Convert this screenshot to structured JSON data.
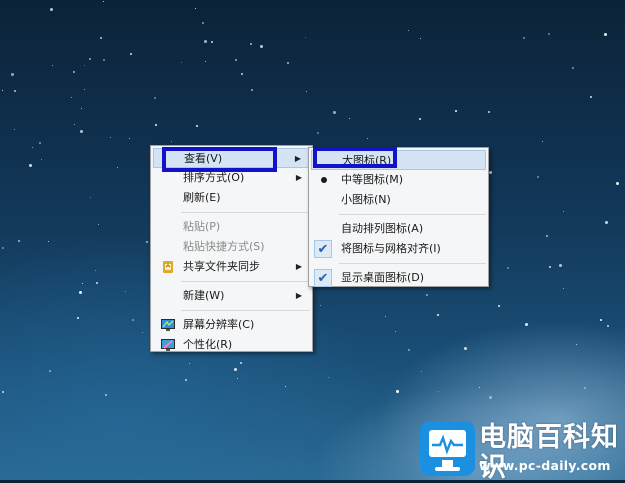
{
  "context_menu": {
    "items": [
      {
        "label": "查看(V)",
        "has_submenu": true,
        "highlighted": true
      },
      {
        "label": "排序方式(O)",
        "has_submenu": true
      },
      {
        "label": "刷新(E)"
      },
      {
        "label": "粘贴(P)",
        "disabled": true
      },
      {
        "label": "粘贴快捷方式(S)",
        "disabled": true
      },
      {
        "label": "共享文件夹同步",
        "has_submenu": true,
        "icon": "sync-folder-icon"
      },
      {
        "label": "新建(W)",
        "has_submenu": true
      },
      {
        "label": "屏幕分辨率(C)",
        "icon": "screen-resolution-icon"
      },
      {
        "label": "个性化(R)",
        "icon": "personalize-icon"
      }
    ]
  },
  "view_submenu": {
    "items": [
      {
        "label": "大图标(R)",
        "highlighted": true
      },
      {
        "label": "中等图标(M)",
        "selected_bullet": true
      },
      {
        "label": "小图标(N)"
      },
      {
        "label": "自动排列图标(A)"
      },
      {
        "label": "将图标与网格对齐(I)",
        "checked": true
      },
      {
        "label": "显示桌面图标(D)",
        "checked": true
      }
    ]
  },
  "watermark": {
    "title": "电脑百科知识",
    "url": "www.pc-daily.com"
  },
  "colors": {
    "annotation_box": "#1212c8",
    "highlight_bg": "#d5e4f4",
    "logo_blue": "#1b8fe0"
  }
}
